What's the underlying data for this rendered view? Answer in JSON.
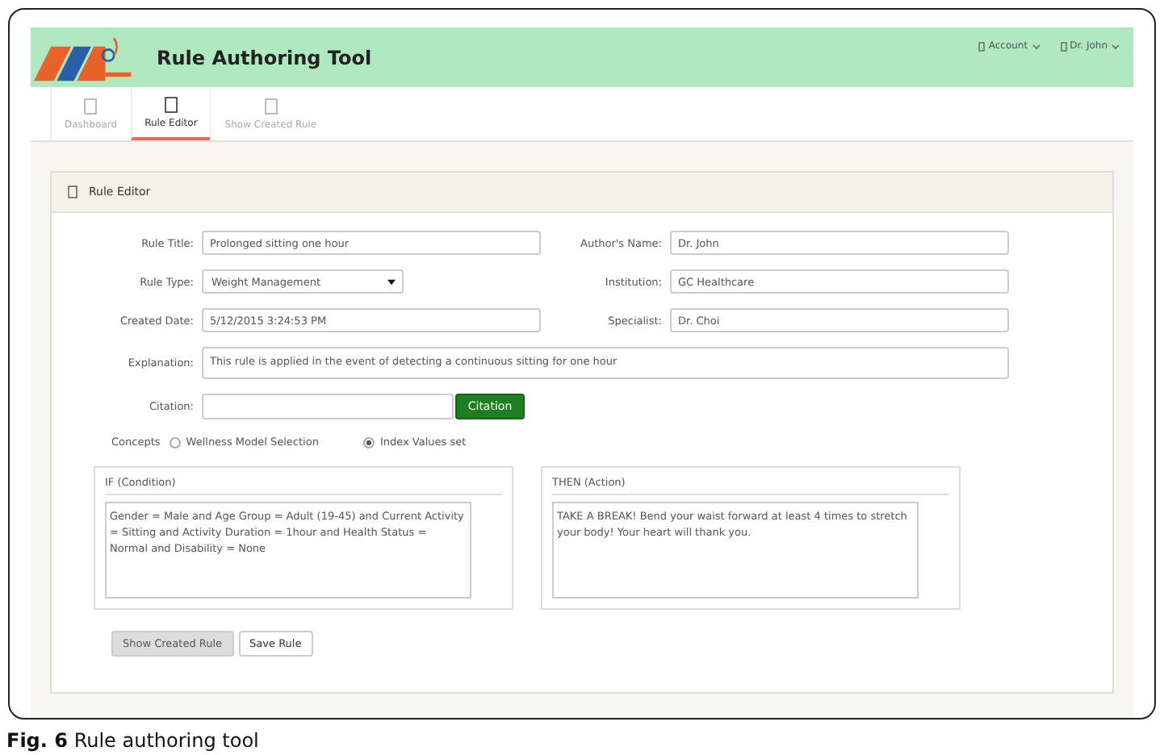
{
  "window": {
    "title": "Rule Authoring Tool"
  },
  "header_menus": [
    {
      "label": "Account"
    },
    {
      "label": "Dr. John"
    }
  ],
  "tabs": [
    {
      "label": "Dashboard",
      "selected": false
    },
    {
      "label": "Rule Editor",
      "selected": true
    },
    {
      "label": "Show Created Rule",
      "selected": false
    }
  ],
  "panel": {
    "title": "Rule Editor"
  },
  "left_fields": [
    {
      "label": "Rule Title:",
      "value": "Prolonged sitting one hour",
      "kind": "text"
    },
    {
      "label": "Rule Type:",
      "value": "Weight Management",
      "kind": "select"
    },
    {
      "label": "Created Date:",
      "value": "5/12/2015 3:24:53 PM",
      "kind": "text"
    }
  ],
  "right_fields": [
    {
      "label": "Author's Name:",
      "value": "Dr. John"
    },
    {
      "label": "Institution:",
      "value": "GC Healthcare"
    },
    {
      "label": "Specialist:",
      "value": "Dr. Choi"
    }
  ],
  "explanation": {
    "label": "Explanation:",
    "value": "This rule is applied in the event of detecting a continuous sitting for one hour"
  },
  "citation": {
    "label": "Citation:",
    "button": "Citation"
  },
  "concepts": {
    "label": "Concepts",
    "options": [
      {
        "label": "Wellness Model Selection",
        "selected": false
      },
      {
        "label": "Index Values set",
        "selected": true
      }
    ]
  },
  "condition": {
    "title": "IF (Condition)",
    "text": "Gender = Male and Age Group = Adult (19-45) and Current Activity = Sitting and Activity Duration = 1hour and Health Status = Normal and Disability = None"
  },
  "action": {
    "title": "THEN (Action)",
    "text": "TAKE A BREAK! Bend your waist forward at least 4 times to stretch your body!  Your heart will thank you."
  },
  "buttons": [
    {
      "label": "Show Created Rule",
      "pressed": true
    },
    {
      "label": "Save Rule",
      "pressed": false
    }
  ],
  "caption": "**Fig. 6** Rule authoring tool"
}
